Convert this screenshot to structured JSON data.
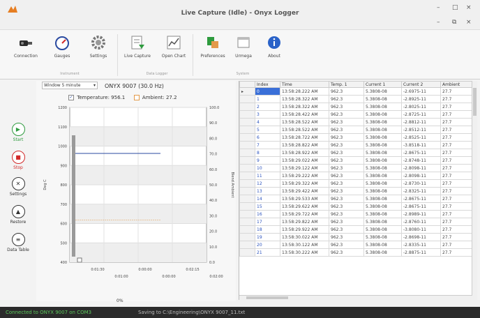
{
  "window": {
    "title": "Live Capture (Idle) - Onyx Logger",
    "minimize": "–",
    "maximize": "□",
    "close": "×",
    "mdi_minimize": "–",
    "mdi_restore": "⧉",
    "mdi_close": "×"
  },
  "ribbon": {
    "buttons": [
      {
        "label": "Connection",
        "icon": "connection-icon"
      },
      {
        "label": "Gauges",
        "icon": "gauge-icon"
      },
      {
        "label": "Settings",
        "icon": "gear-icon"
      },
      {
        "label": "Live Capture",
        "icon": "live-capture-icon"
      },
      {
        "label": "Open Chart",
        "icon": "open-chart-icon"
      },
      {
        "label": "Preferences",
        "icon": "preferences-icon"
      },
      {
        "label": "Urmega",
        "icon": "window-icon"
      },
      {
        "label": "About",
        "icon": "info-icon"
      }
    ],
    "groups": [
      "Instrument",
      "Data Logger",
      "System"
    ]
  },
  "sidenav": [
    {
      "label": "Start",
      "icon": "play-icon",
      "glyph": "▶"
    },
    {
      "label": "Stop",
      "icon": "stop-icon",
      "glyph": "■"
    },
    {
      "label": "Settings",
      "icon": "tools-icon",
      "glyph": "✕"
    },
    {
      "label": "Restore",
      "icon": "restore-icon",
      "glyph": "▲"
    },
    {
      "label": "Data Table",
      "icon": "data-table-icon",
      "glyph": "≡"
    }
  ],
  "chart_panel": {
    "window_select": "Window 5 minute",
    "device_title": "ONYX 9007 (30.0 Hz)",
    "legend": {
      "temperature_label": "Temperature: 956.1",
      "ambient_label": "Ambient: 27.2"
    },
    "progress": "0%"
  },
  "chart_data": {
    "type": "line",
    "ylabel": "Deg C",
    "y2label": "Blend Ambient",
    "ylim": [
      400,
      1200
    ],
    "y2lim": [
      0.0,
      100.0
    ],
    "y_ticks": [
      "1200",
      "1100",
      "1000",
      "900",
      "800",
      "700",
      "600",
      "500",
      "400"
    ],
    "y2_ticks": [
      "100.0",
      "90.0",
      "80.0",
      "70.0",
      "60.0",
      "50.0",
      "40.0",
      "30.0",
      "20.0",
      "10.0",
      "0.0"
    ],
    "x_ticks_top": [
      "0:01:30",
      "0:00:00",
      "0:02:15"
    ],
    "x_ticks_bottom": [
      "0:01:00",
      "0:00:00",
      "0:02:00"
    ],
    "grid": true,
    "series": [
      {
        "name": "Temperature",
        "color": "#2a4aa0",
        "y_start": 962,
        "y_end": 962
      },
      {
        "name": "Ambient",
        "color": "#e39a4a",
        "y_start": 27.2,
        "y_end": 27.2
      }
    ]
  },
  "table": {
    "columns": [
      "Index",
      "Time",
      "Temp. 1",
      "Current 1",
      "Current 2",
      "Ambient"
    ],
    "rows": [
      [
        "0",
        "13:58:28.222 AM",
        "962.3",
        "5.3808-08",
        "-2.6975-11",
        "27.7"
      ],
      [
        "1",
        "13:58:28.322 AM",
        "962.3",
        "5.3808-08",
        "-2.8925-11",
        "27.7"
      ],
      [
        "2",
        "13:58:28.322 AM",
        "962.3",
        "5.3808-08",
        "-2.8025-11",
        "27.7"
      ],
      [
        "3",
        "13:58:28.422 AM",
        "962.3",
        "5.3808-08",
        "-2.8725-11",
        "27.7"
      ],
      [
        "4",
        "13:58:28.522 AM",
        "962.3",
        "5.3808-08",
        "-2.8812-11",
        "27.7"
      ],
      [
        "5",
        "13:58:28.522 AM",
        "962.3",
        "5.3808-08",
        "-2.8512-11",
        "27.7"
      ],
      [
        "6",
        "13:58:28.722 AM",
        "962.3",
        "5.3808-08",
        "-2.8525-11",
        "27.7"
      ],
      [
        "7",
        "13:58:28.822 AM",
        "962.3",
        "5.3808-08",
        "-3.8518-11",
        "27.7"
      ],
      [
        "8",
        "13:58:28.922 AM",
        "962.3",
        "5.3808-08",
        "-2.8675-11",
        "27.7"
      ],
      [
        "9",
        "13:58:29.022 AM",
        "962.3",
        "5.3808-08",
        "-2.8748-11",
        "27.7"
      ],
      [
        "10",
        "13:58:29.122 AM",
        "962.3",
        "5.3808-08",
        "-2.8098-11",
        "27.7"
      ],
      [
        "11",
        "13:58:29.222 AM",
        "962.3",
        "5.3808-08",
        "-2.8098-11",
        "27.7"
      ],
      [
        "12",
        "13:58:29.322 AM",
        "962.3",
        "5.3808-08",
        "-2.8730-11",
        "27.7"
      ],
      [
        "13",
        "13:58:29.422 AM",
        "962.3",
        "5.3808-08",
        "-2.8325-11",
        "27.7"
      ],
      [
        "14",
        "13:58:29.533 AM",
        "962.3",
        "5.3808-08",
        "-2.8675-11",
        "27.7"
      ],
      [
        "15",
        "13:58:29.622 AM",
        "962.3",
        "5.3808-08",
        "-2.8675-11",
        "27.7"
      ],
      [
        "16",
        "13:58:29.722 AM",
        "962.3",
        "5.3808-08",
        "-2.8989-11",
        "27.7"
      ],
      [
        "17",
        "13:58:29.822 AM",
        "962.3",
        "5.3808-08",
        "-2.8760-11",
        "27.7"
      ],
      [
        "18",
        "13:58:29.922 AM",
        "962.3",
        "5.3808-08",
        "-3.8080-11",
        "27.7"
      ],
      [
        "19",
        "13:58:30.022 AM",
        "962.3",
        "5.3808-08",
        "-2.8698-11",
        "27.7"
      ],
      [
        "20",
        "13:58:30.122 AM",
        "962.3",
        "5.3808-08",
        "-2.8335-11",
        "27.7"
      ],
      [
        "21",
        "13:58:30.222 AM",
        "962.3",
        "5.3808-08",
        "-2.8875-11",
        "27.7"
      ]
    ]
  },
  "status": {
    "connection": "Connected to ONYX 9007 on COM3",
    "saving": "Saving to C:\\Engineering\\ONYX 9007_11.txt"
  },
  "colors": {
    "accent": "#3a6fd8",
    "start_green": "#2e9b3e",
    "stop_red": "#d22a2a",
    "status_green": "#5cc85c"
  }
}
